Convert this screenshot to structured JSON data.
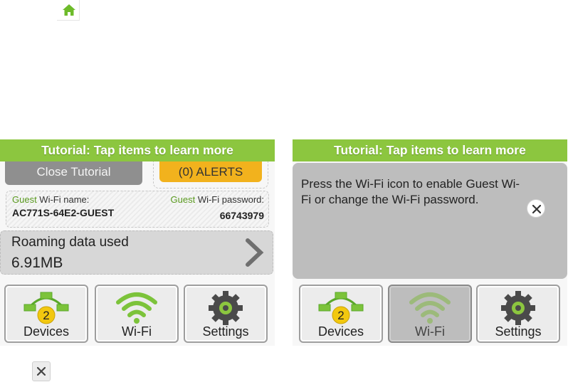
{
  "icons": {
    "home": "home-icon",
    "close": "close-icon",
    "devices": "devices-network-icon",
    "wifi": "wifi-icon",
    "settings": "gear-icon",
    "chevron": "chevron-right-icon"
  },
  "colors": {
    "banner": "#8cc63f",
    "alerts": "#f2b21d",
    "accent_green": "#5a9a1f",
    "badge_yellow": "#f2c80f"
  },
  "left_panel": {
    "banner": "Tutorial: Tap items to learn more",
    "close_tutorial": "Close Tutorial",
    "alerts": "(0) ALERTS",
    "guest_name_prefix": "Guest",
    "guest_name_label": " Wi-Fi name:",
    "guest_name_value": "AC771S-64E2-GUEST",
    "guest_pass_prefix": "Guest",
    "guest_pass_label": " Wi-Fi password:",
    "guest_pass_value": "66743979",
    "roaming_label": "Roaming data used",
    "roaming_value": "6.91MB",
    "tiles": {
      "devices": "Devices",
      "devices_count": "2",
      "wifi": "Wi-Fi",
      "settings": "Settings"
    }
  },
  "right_panel": {
    "banner": "Tutorial: Tap items to learn more",
    "tip": "Press the Wi-Fi icon to enable Guest Wi-Fi or change the Wi-Fi password.",
    "tiles": {
      "devices": "Devices",
      "devices_count": "2",
      "wifi": "Wi-Fi",
      "settings": "Settings"
    }
  }
}
